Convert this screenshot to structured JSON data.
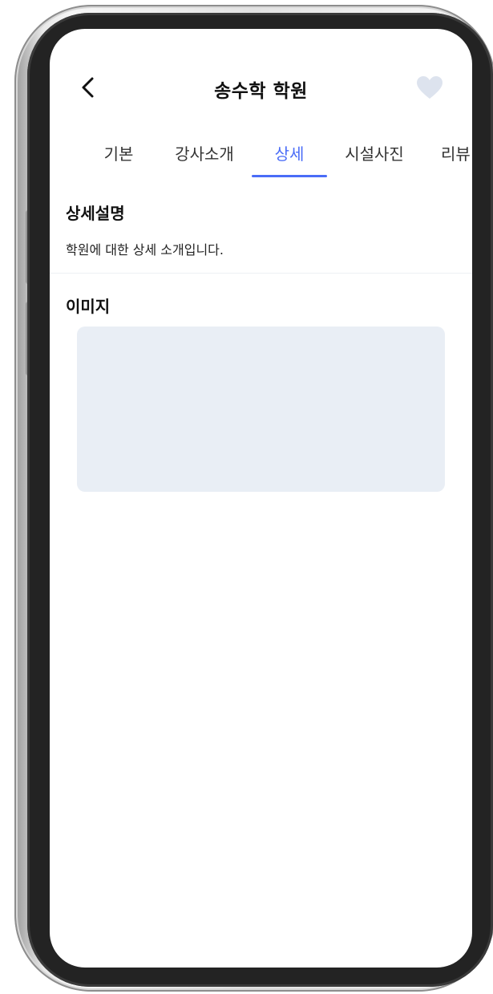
{
  "header": {
    "title": "송수학 학원",
    "back_icon": "chevron-left-icon",
    "favorite_icon": "heart-icon",
    "favorite_color": "#dde3ee"
  },
  "tabs": [
    {
      "label": "기본",
      "active": false
    },
    {
      "label": "강사소개",
      "active": false
    },
    {
      "label": "상세",
      "active": true
    },
    {
      "label": "시설사진",
      "active": false
    },
    {
      "label": "리뷰",
      "active": false
    }
  ],
  "accent_color": "#4a6cf7",
  "detail": {
    "title": "상세설명",
    "description": "학원에 대한 상세 소개입니다."
  },
  "images": {
    "title": "이미지"
  }
}
